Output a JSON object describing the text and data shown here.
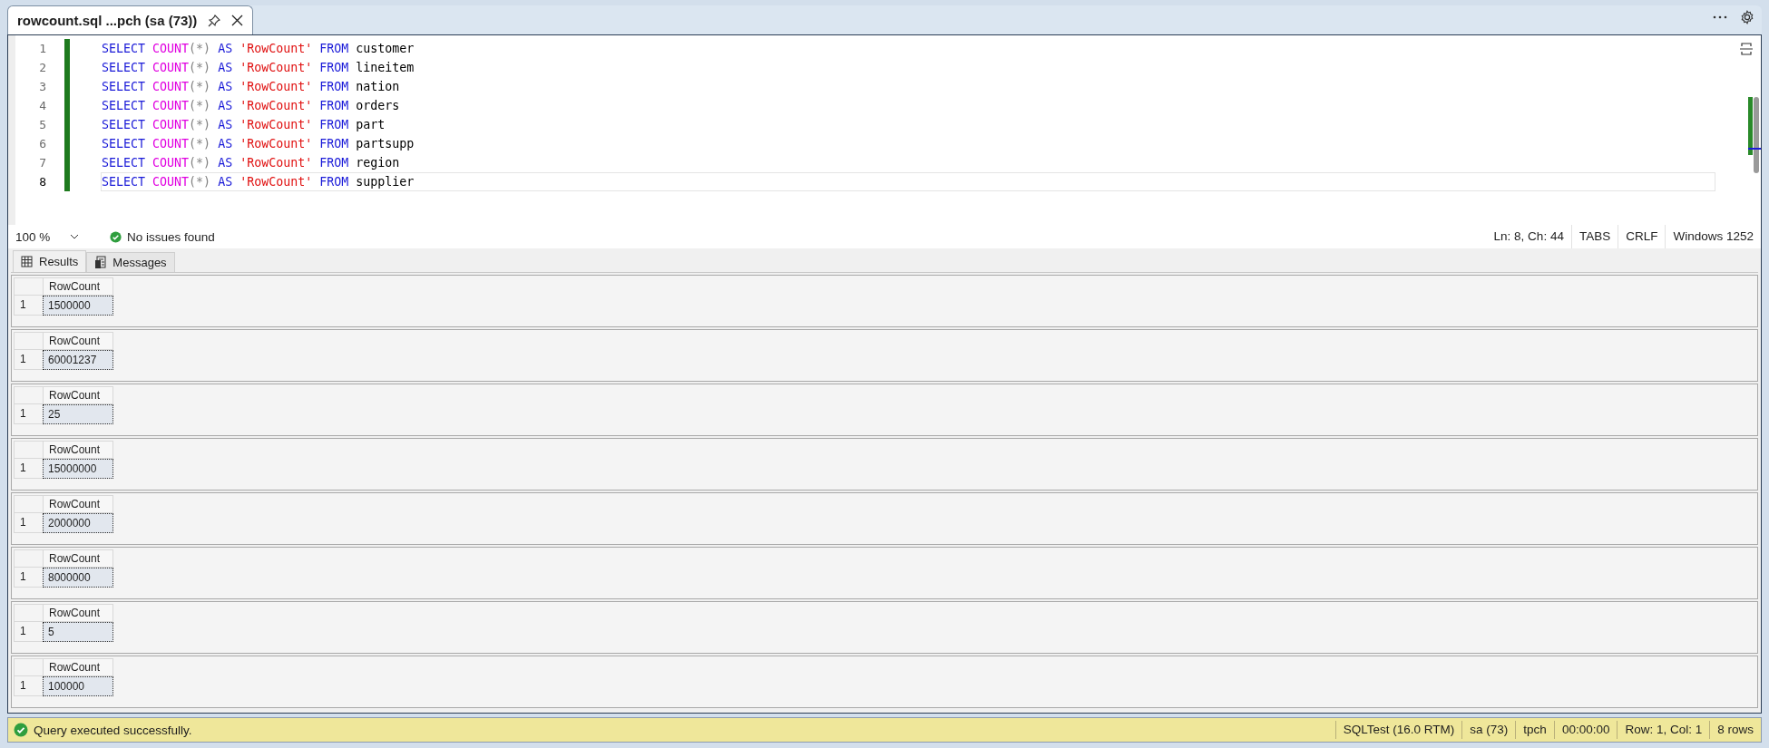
{
  "document_tab": {
    "title": "rowcount.sql ...pch (sa (73))",
    "selected": true
  },
  "editor": {
    "lines": [
      {
        "number": "1",
        "current": false,
        "tokens": [
          {
            "kind": "keyword",
            "text": "SELECT"
          },
          {
            "kind": "function",
            "text": "COUNT"
          },
          {
            "kind": "paren",
            "text": "(*)"
          },
          {
            "kind": "keyword",
            "text": "AS"
          },
          {
            "kind": "string",
            "text": "'RowCount'"
          },
          {
            "kind": "keyword",
            "text": "FROM"
          },
          {
            "kind": "name",
            "text": "customer"
          }
        ]
      },
      {
        "number": "2",
        "current": false,
        "tokens": [
          {
            "kind": "keyword",
            "text": "SELECT"
          },
          {
            "kind": "function",
            "text": "COUNT"
          },
          {
            "kind": "paren",
            "text": "(*)"
          },
          {
            "kind": "keyword",
            "text": "AS"
          },
          {
            "kind": "string",
            "text": "'RowCount'"
          },
          {
            "kind": "keyword",
            "text": "FROM"
          },
          {
            "kind": "name",
            "text": "lineitem"
          }
        ]
      },
      {
        "number": "3",
        "current": false,
        "tokens": [
          {
            "kind": "keyword",
            "text": "SELECT"
          },
          {
            "kind": "function",
            "text": "COUNT"
          },
          {
            "kind": "paren",
            "text": "(*)"
          },
          {
            "kind": "keyword",
            "text": "AS"
          },
          {
            "kind": "string",
            "text": "'RowCount'"
          },
          {
            "kind": "keyword",
            "text": "FROM"
          },
          {
            "kind": "name",
            "text": "nation"
          }
        ]
      },
      {
        "number": "4",
        "current": false,
        "tokens": [
          {
            "kind": "keyword",
            "text": "SELECT"
          },
          {
            "kind": "function",
            "text": "COUNT"
          },
          {
            "kind": "paren",
            "text": "(*)"
          },
          {
            "kind": "keyword",
            "text": "AS"
          },
          {
            "kind": "string",
            "text": "'RowCount'"
          },
          {
            "kind": "keyword",
            "text": "FROM"
          },
          {
            "kind": "name",
            "text": "orders"
          }
        ]
      },
      {
        "number": "5",
        "current": false,
        "tokens": [
          {
            "kind": "keyword",
            "text": "SELECT"
          },
          {
            "kind": "function",
            "text": "COUNT"
          },
          {
            "kind": "paren",
            "text": "(*)"
          },
          {
            "kind": "keyword",
            "text": "AS"
          },
          {
            "kind": "string",
            "text": "'RowCount'"
          },
          {
            "kind": "keyword",
            "text": "FROM"
          },
          {
            "kind": "name",
            "text": "part"
          }
        ]
      },
      {
        "number": "6",
        "current": false,
        "tokens": [
          {
            "kind": "keyword",
            "text": "SELECT"
          },
          {
            "kind": "function",
            "text": "COUNT"
          },
          {
            "kind": "paren",
            "text": "(*)"
          },
          {
            "kind": "keyword",
            "text": "AS"
          },
          {
            "kind": "string",
            "text": "'RowCount'"
          },
          {
            "kind": "keyword",
            "text": "FROM"
          },
          {
            "kind": "name",
            "text": "partsupp"
          }
        ]
      },
      {
        "number": "7",
        "current": false,
        "tokens": [
          {
            "kind": "keyword",
            "text": "SELECT"
          },
          {
            "kind": "function",
            "text": "COUNT"
          },
          {
            "kind": "paren",
            "text": "(*)"
          },
          {
            "kind": "keyword",
            "text": "AS"
          },
          {
            "kind": "string",
            "text": "'RowCount'"
          },
          {
            "kind": "keyword",
            "text": "FROM"
          },
          {
            "kind": "name",
            "text": "region"
          }
        ]
      },
      {
        "number": "8",
        "current": true,
        "tokens": [
          {
            "kind": "keyword",
            "text": "SELECT"
          },
          {
            "kind": "function",
            "text": "COUNT"
          },
          {
            "kind": "paren",
            "text": "(*)"
          },
          {
            "kind": "keyword",
            "text": "AS"
          },
          {
            "kind": "string",
            "text": "'RowCount'"
          },
          {
            "kind": "keyword",
            "text": "FROM"
          },
          {
            "kind": "name",
            "text": "supplier"
          }
        ]
      }
    ]
  },
  "editor_status": {
    "zoom": "100 %",
    "issues": "No issues found",
    "position": "Ln: 8, Ch: 44",
    "indent": "TABS",
    "line_ending": "CRLF",
    "encoding": "Windows 1252"
  },
  "result_tabs": [
    {
      "label": "Results",
      "selected": true
    },
    {
      "label": "Messages",
      "selected": false
    }
  ],
  "result_grids": [
    {
      "column": "RowCount",
      "row": "1",
      "value": "1500000"
    },
    {
      "column": "RowCount",
      "row": "1",
      "value": "60001237"
    },
    {
      "column": "RowCount",
      "row": "1",
      "value": "25"
    },
    {
      "column": "RowCount",
      "row": "1",
      "value": "15000000"
    },
    {
      "column": "RowCount",
      "row": "1",
      "value": "2000000"
    },
    {
      "column": "RowCount",
      "row": "1",
      "value": "8000000"
    },
    {
      "column": "RowCount",
      "row": "1",
      "value": "5"
    },
    {
      "column": "RowCount",
      "row": "1",
      "value": "100000"
    }
  ],
  "status_bar": {
    "message": "Query executed successfully.",
    "items": [
      "SQLTest (16.0 RTM)",
      "sa (73)",
      "tpch",
      "00:00:00",
      "Row: 1, Col: 1",
      "8 rows"
    ]
  }
}
